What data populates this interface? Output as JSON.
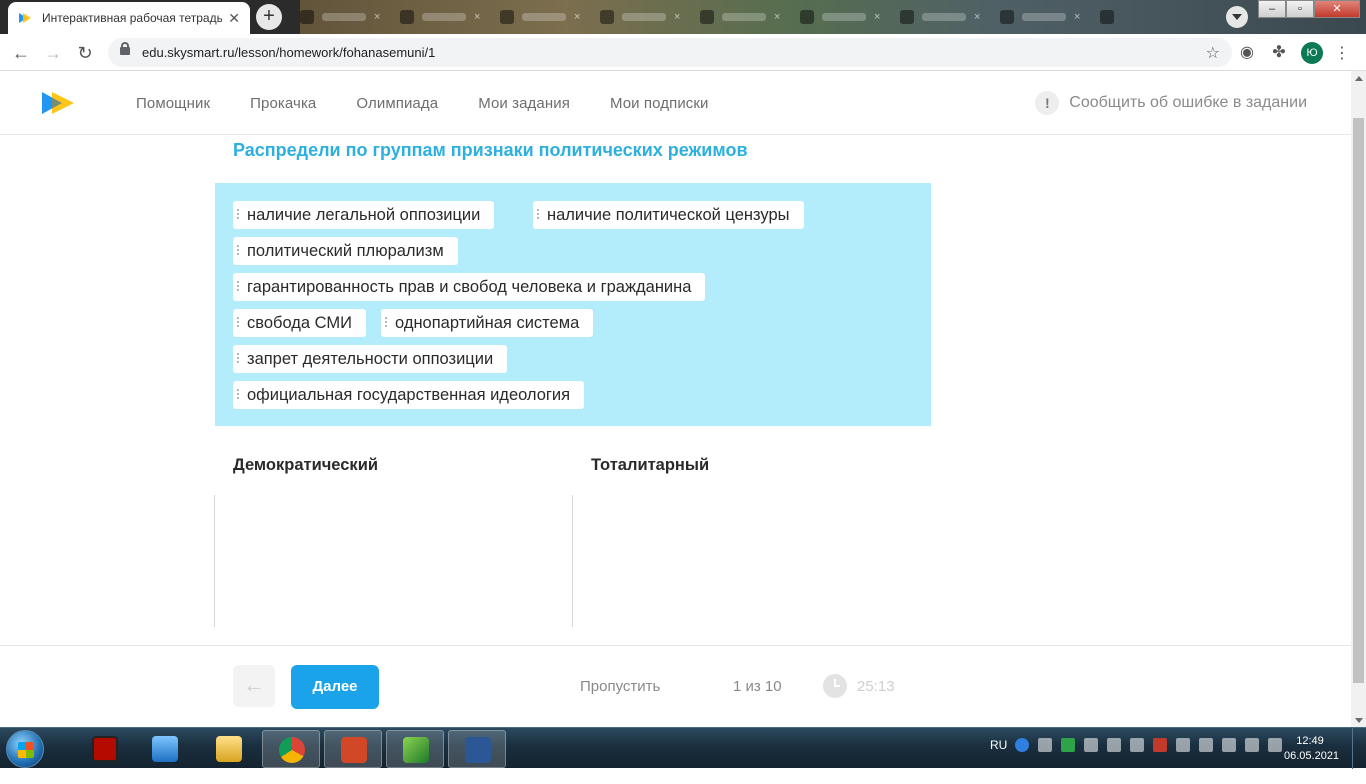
{
  "browser": {
    "tab_title": "Интерактивная рабочая тетрадь",
    "url": "edu.skysmart.ru/lesson/homework/fohanasemuni/1",
    "profile_initial": "Ю",
    "background_tab_glyph": "×"
  },
  "header": {
    "nav": [
      "Помощник",
      "Прокачка",
      "Олимпиада",
      "Мои задания",
      "Мои подписки"
    ],
    "report_icon": "!",
    "report_label": "Сообщить об ошибке в задании"
  },
  "task": {
    "title": "Распредели по группам признаки политических режимов",
    "options": [
      "наличие легальной оппозиции",
      "наличие политической цензуры",
      "политический плюрализм",
      "гарантированность прав и свобод человека и гражданина",
      "свобода СМИ",
      "однопартийная система",
      "запрет деятельности оппозиции",
      "официальная государственная идеология"
    ],
    "groups": [
      "Демократический",
      "Тоталитарный"
    ]
  },
  "footer": {
    "back_icon": "←",
    "next_label": "Далее",
    "skip_label": "Пропустить",
    "progress": "1 из 10",
    "timer": "25:13"
  },
  "taskbar": {
    "language": "RU",
    "time": "12:49",
    "date": "06.05.2021"
  },
  "colors": {
    "accent": "#1aa3e8",
    "title": "#2cb0e0",
    "pool_bg": "#b3ecfa",
    "logo_blue": "#2196f3",
    "logo_yellow": "#ffc107"
  },
  "icons": [
    "back-arrow-icon",
    "forward-arrow-icon",
    "reload-icon",
    "lock-icon",
    "star-icon",
    "puzzle-icon",
    "eye-icon",
    "menu-icon",
    "clock-icon",
    "drag-handle-icon"
  ]
}
